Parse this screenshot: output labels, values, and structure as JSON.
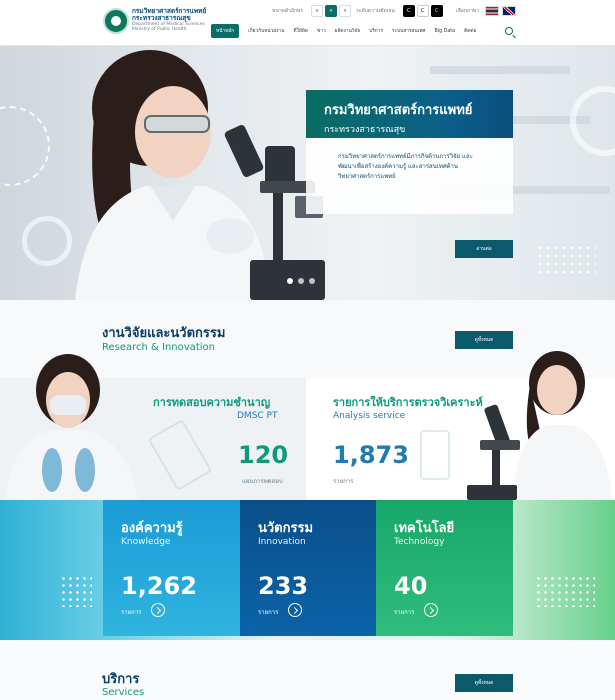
{
  "header": {
    "org_th_1": "กรมวิทยาศาสตร์การแพทย์",
    "org_th_2": "กระทรวงสาธารณสุข",
    "org_en_1": "Department of Medical Sciences",
    "org_en_2": "Ministry of Public Health",
    "font_size_label": "ขนาดตัวอักษร",
    "font_sizes": [
      "ก",
      "ก",
      "ก"
    ],
    "contrast_label": "ระดับความชัดเจน",
    "contrast": [
      "C",
      "C",
      "C"
    ],
    "language_label": "เลือกภาษา",
    "nav": [
      "หน้าหลัก",
      "เกี่ยวกับหน่วยงาน",
      "ที่ให้ผิด",
      "ข่าว",
      "ผลิตงานวิจัย",
      "บริการ",
      "ระบบสารสนเทศ",
      "Big Data",
      "ติดต่อ"
    ]
  },
  "hero": {
    "title": "กรมวิทยาศาสตร์การแพทย์",
    "subtitle": "กระทรวงสาธารณสุข",
    "desc_1": "กรมวิทยาศาสตร์การแพทย์มีภารกิจด้านการวิจัย และ",
    "desc_2": "พัฒนาเพื่อสร้างองค์ความรู้ และสารสนเทศด้าน",
    "desc_3": "วิทยาศาสตร์การแพทย์",
    "button": "อ่านต่อ"
  },
  "research": {
    "title": "งานวิจัยและนวัตกรรม",
    "subtitle": "Research & Innovation",
    "all_button": "ดูทั้งหมด",
    "pt": {
      "title": "การทดสอบความชำนาญ",
      "en": "DMSC PT",
      "value": "120",
      "unit": "แผนการทดสอบ"
    },
    "analysis": {
      "title": "รายการให้บริการตรวจวิเคราะห์",
      "en": "Analysis service",
      "value": "1,873",
      "unit": "รายการ"
    }
  },
  "tiles": [
    {
      "th": "องค์ความรู้",
      "en": "Knowledge",
      "value": "1,262",
      "unit": "รายการ"
    },
    {
      "th": "นวัตกรรม",
      "en": "Innovation",
      "value": "233",
      "unit": "รายการ"
    },
    {
      "th": "เทคโนโลยี",
      "en": "Technology",
      "value": "40",
      "unit": "รายการ"
    }
  ],
  "services": {
    "title": "บริการ",
    "subtitle": "Services",
    "all_button": "ดูทั้งหมด"
  },
  "colors": {
    "primary": "#0b6e66",
    "navy": "#0b3f66",
    "green": "#0f9a7a",
    "blue": "#1f7ab5"
  }
}
